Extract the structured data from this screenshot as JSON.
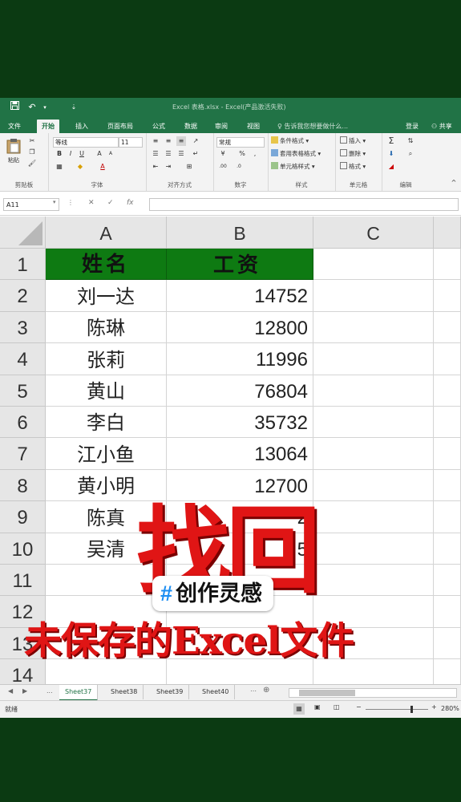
{
  "window": {
    "title": "Excel 表格.xlsx - Excel(产品激活失败)"
  },
  "ribbon_tabs": [
    "文件",
    "开始",
    "插入",
    "页面布局",
    "公式",
    "数据",
    "审阅",
    "视图"
  ],
  "tell_me": "♀ 告诉我您想要做什么...",
  "account": {
    "login": "登录",
    "share": "共享"
  },
  "ribbon": {
    "clipboard": {
      "paste": "粘贴",
      "label": "剪贴板"
    },
    "font": {
      "name": "等线",
      "size": "11",
      "label": "字体"
    },
    "alignment": {
      "label": "对齐方式"
    },
    "number": {
      "format": "常规",
      "label": "数字"
    },
    "styles": {
      "conditional": "条件格式",
      "table": "套用表格格式",
      "cell": "单元格样式",
      "label": "样式"
    },
    "cells": {
      "insert": "插入",
      "delete": "删除",
      "format": "格式",
      "label": "单元格"
    },
    "editing": {
      "label": "编辑"
    }
  },
  "formula_bar": {
    "name_box": "A11",
    "fx": "fx",
    "value": ""
  },
  "columns": [
    "A",
    "B",
    "C"
  ],
  "rows": [
    {
      "row": "1",
      "name": "姓名",
      "salary": "工资"
    },
    {
      "row": "2",
      "name": "刘一达",
      "salary": "14752"
    },
    {
      "row": "3",
      "name": "陈琳",
      "salary": "12800"
    },
    {
      "row": "4",
      "name": "张莉",
      "salary": "11996"
    },
    {
      "row": "5",
      "name": "黄山",
      "salary": "76804"
    },
    {
      "row": "6",
      "name": "李白",
      "salary": "35732"
    },
    {
      "row": "7",
      "name": "江小鱼",
      "salary": "13064"
    },
    {
      "row": "8",
      "name": "黄小明",
      "salary": "12700"
    },
    {
      "row": "9",
      "name": "陈真",
      "salary": "2"
    },
    {
      "row": "10",
      "name": "吴清",
      "salary": "5"
    },
    {
      "row": "11",
      "name": "",
      "salary": ""
    },
    {
      "row": "12",
      "name": "",
      "salary": ""
    },
    {
      "row": "13",
      "name": "",
      "salary": ""
    },
    {
      "row": "14",
      "name": "",
      "salary": ""
    }
  ],
  "sheets": {
    "ellipsis": "...",
    "tabs": [
      "Sheet37",
      "Sheet38",
      "Sheet39",
      "Sheet40"
    ],
    "active": "Sheet37"
  },
  "status": {
    "ready": "就绪",
    "zoom": "280%"
  },
  "overlay": {
    "title": "找回",
    "hashtag_symbol": "#",
    "hashtag": "创作灵感",
    "subtitle": "未保存的Excel文件"
  },
  "colors": {
    "excel_green": "#217346",
    "header_fill": "#0e7a12",
    "overlay_red": "#e01515",
    "hashtag_blue": "#1c8ef2",
    "background": "#0b3a12"
  }
}
